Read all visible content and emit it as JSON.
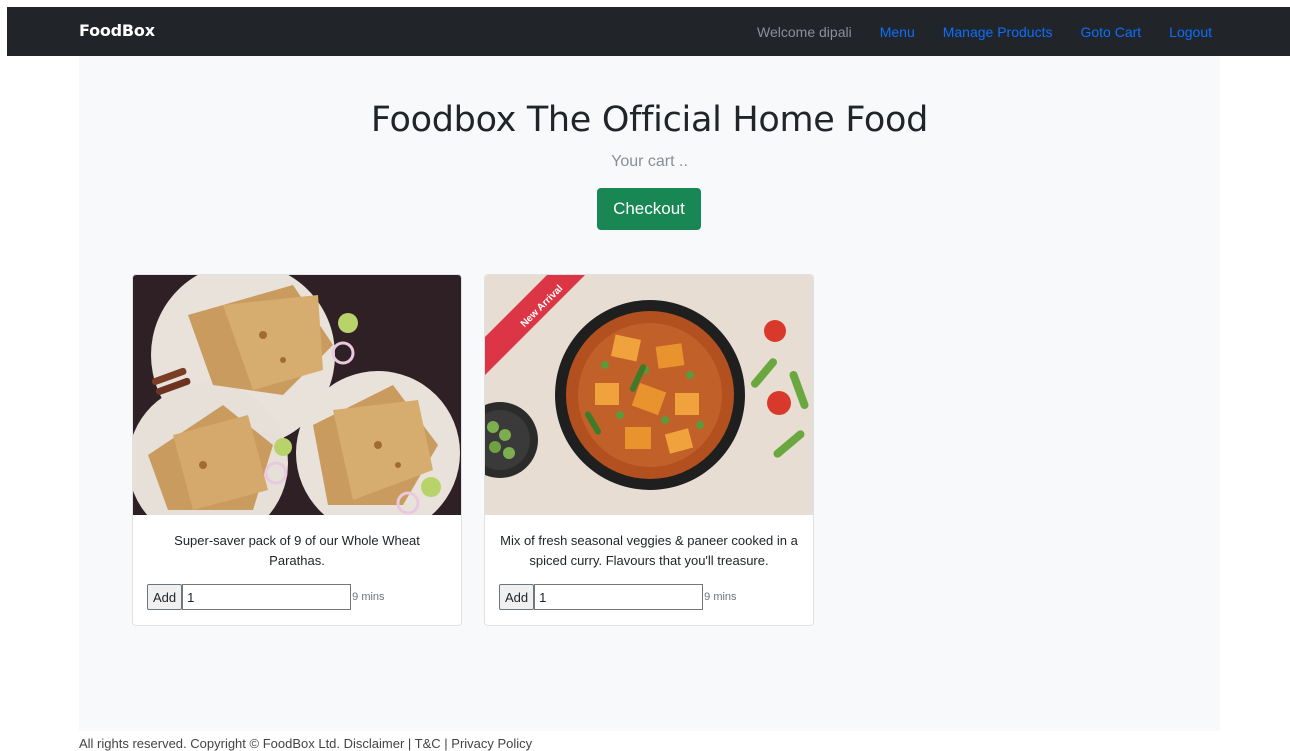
{
  "navbar": {
    "brand": "FoodBox",
    "welcome": "Welcome dipali",
    "links": [
      "Menu",
      "Manage Products",
      "Goto Cart",
      "Logout"
    ]
  },
  "main": {
    "title": "Foodbox The Official Home Food",
    "subtitle": "Your cart ..",
    "checkout_label": "Checkout"
  },
  "products": [
    {
      "description": "Super-saver pack of 9 of our Whole Wheat Parathas.",
      "add_label": "Add",
      "quantity": "1",
      "time": "9 mins"
    },
    {
      "ribbon": "New Arrival",
      "description": "Mix of fresh seasonal veggies & paneer cooked in a spiced curry. Flavours that you'll treasure.",
      "add_label": "Add",
      "quantity": "1",
      "time": "9 mins"
    }
  ],
  "footer": {
    "text": "All rights reserved. Copyright © FoodBox Ltd. Disclaimer | T&C | Privacy Policy"
  },
  "colors": {
    "navbar_bg": "#212529",
    "link": "#0d6efd",
    "checkout": "#198754",
    "ribbon": "#dc3545"
  }
}
